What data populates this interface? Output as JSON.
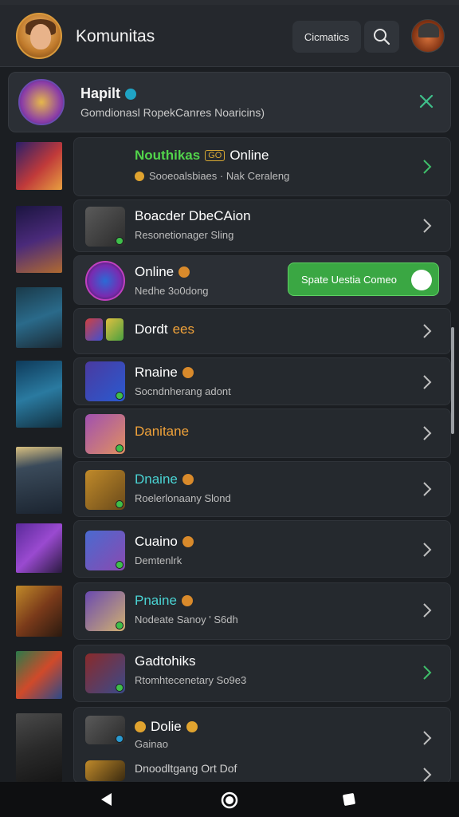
{
  "app": {
    "title": "Komunitas",
    "filter_label": "Cicmatics",
    "logo_icon": "portrait-icon",
    "search_icon": "search-icon",
    "avatar_icon": "user-avatar"
  },
  "featured": {
    "name": "Hapilt",
    "description": "Gomdionasl RopekCanres Noaricins)",
    "verified_icon": "verified-badge-icon",
    "close_icon": "close-icon"
  },
  "list": [
    {
      "title_highlight": "Nouthikas",
      "badge": "GO",
      "title": "Online",
      "subtitle": "Sooeoalsbiaes · Nak Ceraleng",
      "chevron_color": "#3fbf6a"
    },
    {
      "title": "Boacder DbeCAion",
      "subtitle": "Resonetionager Sling",
      "chevron_color": "#bfbfbf"
    },
    {
      "title": "Online",
      "subtitle": "Nedhe 3o0dong",
      "toggle_label": "Spate Uestia Comeo",
      "chevron_color": ""
    },
    {
      "title": "Dordt",
      "title_suffix": "ees",
      "subtitle": "",
      "chevron_color": "#bfbfbf"
    },
    {
      "title": "Rnaine",
      "subtitle": "Socndnherang adont",
      "chevron_color": "#bfbfbf"
    },
    {
      "title": "Danitane",
      "subtitle": "",
      "chevron_color": "#bfbfbf"
    },
    {
      "title": "Dnaine",
      "subtitle": "Roelerlonaany Slond",
      "chevron_color": "#bfbfbf"
    },
    {
      "title": "Cuaino",
      "subtitle": "Demtenlrk",
      "chevron_color": "#bfbfbf"
    },
    {
      "title": "Pnaine",
      "subtitle": "Nodeate Sanoy ' S6dh",
      "chevron_color": "#bfbfbf"
    },
    {
      "title": "Gadtohiks",
      "subtitle": "Rtomhtecenetary So9e3",
      "chevron_color": "#3fbf6a"
    },
    {
      "title": "Dolie",
      "subtitle": "Gainao",
      "subtitle2": "Dnoodltgang Ort Dof",
      "chevron_color": "#bfbfbf"
    }
  ],
  "navbar": {
    "back_icon": "back-triangle-icon",
    "home_icon": "home-circle-icon",
    "recent_icon": "recent-square-icon"
  }
}
